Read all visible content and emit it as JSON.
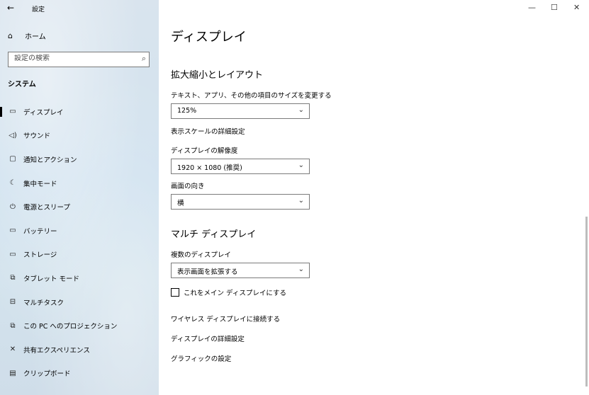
{
  "window": {
    "title": "設定",
    "minimize": "—",
    "maximize": "☐",
    "close": "✕"
  },
  "sidebar": {
    "back": "←",
    "home": "ホーム",
    "search_placeholder": "設定の検索",
    "section": "システム",
    "items": [
      {
        "label": "ディスプレイ",
        "icon": "monitor-icon",
        "glyph": "▭",
        "selected": true
      },
      {
        "label": "サウンド",
        "icon": "speaker-icon",
        "glyph": "🔊"
      },
      {
        "label": "通知とアクション",
        "icon": "notification-icon",
        "glyph": "▢"
      },
      {
        "label": "集中モード",
        "icon": "moon-icon",
        "glyph": "☾"
      },
      {
        "label": "電源とスリープ",
        "icon": "power-icon",
        "glyph": "⏻"
      },
      {
        "label": "バッテリー",
        "icon": "battery-icon",
        "glyph": "▭"
      },
      {
        "label": "ストレージ",
        "icon": "storage-icon",
        "glyph": "▭"
      },
      {
        "label": "タブレット モード",
        "icon": "tablet-icon",
        "glyph": "⧉"
      },
      {
        "label": "マルチタスク",
        "icon": "multitask-icon",
        "glyph": "⊟"
      },
      {
        "label": "この PC へのプロジェクション",
        "icon": "projection-icon",
        "glyph": "⧉"
      },
      {
        "label": "共有エクスペリエンス",
        "icon": "shared-icon",
        "glyph": "✕"
      },
      {
        "label": "クリップボード",
        "icon": "clipboard-icon",
        "glyph": "📋"
      }
    ]
  },
  "main": {
    "title": "ディスプレイ",
    "scale_section": {
      "heading": "拡大縮小とレイアウト",
      "scale_label": "テキスト、アプリ、その他の項目のサイズを変更する",
      "scale_value": "125%",
      "advanced_scale_link": "表示スケールの詳細設定",
      "resolution_label": "ディスプレイの解像度",
      "resolution_value": "1920 × 1080 (推奨)",
      "orientation_label": "画面の向き",
      "orientation_value": "横"
    },
    "multi_section": {
      "heading": "マルチ ディスプレイ",
      "multi_label": "複数のディスプレイ",
      "multi_value": "表示画面を拡張する",
      "main_display_checkbox": "これをメイン ディスプレイにする",
      "checked": false,
      "wireless_link": "ワイヤレス ディスプレイに接続する",
      "advanced_display_link": "ディスプレイの詳細設定",
      "graphics_link": "グラフィックの設定"
    }
  }
}
